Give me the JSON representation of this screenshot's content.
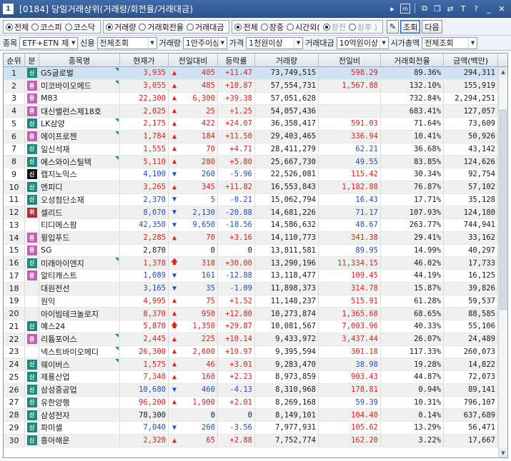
{
  "window": {
    "number": "1",
    "title": "[0184] 당일거래상위(거래량/회전율/거래대금)",
    "icons": [
      "arrow-right-icon",
      "m-box-icon",
      "window-split-icon",
      "copy-icon",
      "swap-icon",
      "font-size-icon",
      "help-icon",
      "minimize-icon",
      "close-icon"
    ]
  },
  "toolbar1": {
    "market": [
      {
        "label": "전체",
        "checked": true
      },
      {
        "label": "코스피",
        "checked": false
      },
      {
        "label": "코스닥",
        "checked": false
      }
    ],
    "sort": [
      {
        "label": "거래량",
        "checked": true
      },
      {
        "label": "거래회전율",
        "checked": false
      },
      {
        "label": "거래대금",
        "checked": false
      }
    ],
    "time": [
      {
        "label": "전체",
        "checked": true
      },
      {
        "label": "장중",
        "checked": false
      },
      {
        "label": "시간외(",
        "checked": false
      },
      {
        "label": "장전",
        "checked": true,
        "dim": true
      },
      {
        "label": "장후 )",
        "checked": false,
        "dim": true
      }
    ],
    "settings_icon": "wand-icon",
    "query_label": "조회",
    "next_label": "다음"
  },
  "toolbar2": {
    "item_label": "종목",
    "item_value": "ETF+ETN 제",
    "credit_label": "신용",
    "credit_value": "전체조회",
    "volume_label": "거래량",
    "volume_value": "1만주이상",
    "price_label": "가격",
    "price_value": "1천원이상",
    "amount_label": "거래대금",
    "amount_value": "10억원이상",
    "cap_label": "시가총액",
    "cap_value": "전체조회"
  },
  "table": {
    "columns": [
      "순위",
      "분",
      "종목명",
      "현재가",
      "전일대비",
      "등락률",
      "거래량",
      "전일비",
      "거래회전율",
      "금액(백만)"
    ],
    "rows": [
      {
        "rank": "1",
        "badge": "신",
        "badge_color": "green",
        "name": "GS글로벌",
        "mark": true,
        "price": "3,935",
        "dir": "up",
        "change": "405",
        "rate": "+11.47",
        "volume": "73,749,515",
        "prev_ratio": "598.29",
        "turnover": "89.36%",
        "amount": "294,311"
      },
      {
        "rank": "2",
        "badge": "증",
        "badge_color": "pink",
        "name": "미코바이오메드",
        "mark": true,
        "price": "3,055",
        "dir": "up",
        "change": "485",
        "rate": "+18.87",
        "volume": "57,554,731",
        "prev_ratio": "1,567.88",
        "turnover": "132.10%",
        "amount": "155,919"
      },
      {
        "rank": "3",
        "badge": "증",
        "badge_color": "pink",
        "name": "M83",
        "mark": false,
        "price": "22,300",
        "dir": "up",
        "change": "6,300",
        "rate": "+39.38",
        "volume": "57,051,628",
        "prev_ratio": "",
        "turnover": "732.84%",
        "amount": "2,294,251"
      },
      {
        "rank": "4",
        "badge": "증",
        "badge_color": "pink",
        "name": "대신밸런스제18호",
        "mark": false,
        "price": "2,025",
        "dir": "up",
        "change": "25",
        "rate": "+1.25",
        "volume": "54,057,436",
        "prev_ratio": "",
        "turnover": "683.41%",
        "amount": "127,057"
      },
      {
        "rank": "5",
        "badge": "신",
        "badge_color": "green",
        "name": "LK삼양",
        "mark": true,
        "price": "2,175",
        "dir": "up",
        "change": "422",
        "rate": "+24.07",
        "volume": "36,358,417",
        "prev_ratio": "591.03",
        "turnover": "71.64%",
        "amount": "73,609"
      },
      {
        "rank": "6",
        "badge": "증",
        "badge_color": "pink",
        "name": "에이프로젠",
        "mark": true,
        "price": "1,784",
        "dir": "up",
        "change": "184",
        "rate": "+11.50",
        "volume": "29,403,465",
        "prev_ratio": "336.94",
        "turnover": "10.41%",
        "amount": "50,926"
      },
      {
        "rank": "7",
        "badge": "신",
        "badge_color": "green",
        "name": "일신석재",
        "mark": false,
        "price": "1,555",
        "dir": "up",
        "change": "70",
        "rate": "+4.71",
        "volume": "28,411,279",
        "prev_ratio": "62.21",
        "turnover": "36.68%",
        "amount": "43,142"
      },
      {
        "rank": "8",
        "badge": "신",
        "badge_color": "green",
        "name": "에스와이스틸텍",
        "mark": true,
        "price": "5,110",
        "dir": "up",
        "change": "280",
        "rate": "+5.80",
        "volume": "25,667,730",
        "prev_ratio": "49.55",
        "turnover": "83.85%",
        "amount": "124,626"
      },
      {
        "rank": "9",
        "badge": "신",
        "badge_color": "black",
        "name": "랩지노믹스",
        "mark": false,
        "price": "4,100",
        "dir": "down",
        "change": "260",
        "rate": "-5.96",
        "volume": "22,526,081",
        "prev_ratio": "115.42",
        "turnover": "30.34%",
        "amount": "92,754"
      },
      {
        "rank": "10",
        "badge": "신",
        "badge_color": "green",
        "name": "엔피디",
        "mark": false,
        "price": "3,265",
        "dir": "up",
        "change": "345",
        "rate": "+11.82",
        "volume": "16,553,843",
        "prev_ratio": "1,182.88",
        "turnover": "76.87%",
        "amount": "57,102"
      },
      {
        "rank": "11",
        "badge": "신",
        "badge_color": "green",
        "name": "오성첨단소재",
        "mark": false,
        "price": "2,370",
        "dir": "down",
        "change": "5",
        "rate": "-0.21",
        "volume": "15,062,794",
        "prev_ratio": "16.43",
        "turnover": "17.71%",
        "amount": "35,128"
      },
      {
        "rank": "12",
        "badge": "위",
        "badge_color": "red",
        "name": "셀리드",
        "mark": false,
        "price": "8,070",
        "dir": "down",
        "change": "2,130",
        "rate": "-20.88",
        "volume": "14,681,226",
        "prev_ratio": "71.17",
        "turnover": "107.93%",
        "amount": "124,180"
      },
      {
        "rank": "13",
        "badge": "",
        "badge_color": "",
        "name": "티디에스팜",
        "mark": false,
        "price": "42,350",
        "dir": "down",
        "change": "9,650",
        "rate": "-18.56",
        "volume": "14,586,632",
        "prev_ratio": "48.67",
        "turnover": "263.77%",
        "amount": "744,941"
      },
      {
        "rank": "14",
        "badge": "증",
        "badge_color": "pink",
        "name": "윙입푸드",
        "mark": false,
        "price": "2,285",
        "dir": "up",
        "change": "70",
        "rate": "+3.16",
        "volume": "14,110,773",
        "prev_ratio": "341.38",
        "turnover": "29.41%",
        "amount": "33,162"
      },
      {
        "rank": "15",
        "badge": "증",
        "badge_color": "pink",
        "name": "SG",
        "mark": false,
        "price": "2,870",
        "dir": "flat",
        "change": "0",
        "rate": "0",
        "volume": "13,811,581",
        "prev_ratio": "89.95",
        "turnover": "14.99%",
        "amount": "40,297"
      },
      {
        "rank": "16",
        "badge": "신",
        "badge_color": "green",
        "name": "미래아이앤지",
        "mark": true,
        "price": "1,378",
        "dir": "upper",
        "change": "318",
        "rate": "+30.00",
        "volume": "13,290,196",
        "prev_ratio": "11,334.15",
        "turnover": "46.02%",
        "amount": "17,733"
      },
      {
        "rank": "17",
        "badge": "증",
        "badge_color": "pink",
        "name": "알티캐스트",
        "mark": false,
        "price": "1,089",
        "dir": "down",
        "change": "161",
        "rate": "-12.88",
        "volume": "13,118,477",
        "prev_ratio": "109.45",
        "turnover": "44.19%",
        "amount": "16,125"
      },
      {
        "rank": "18",
        "badge": "",
        "badge_color": "",
        "name": "대원전선",
        "mark": false,
        "price": "3,165",
        "dir": "down",
        "change": "35",
        "rate": "-1.09",
        "volume": "11,898,373",
        "prev_ratio": "314.78",
        "turnover": "15.87%",
        "amount": "39,826"
      },
      {
        "rank": "19",
        "badge": "",
        "badge_color": "",
        "name": "원익",
        "mark": false,
        "price": "4,995",
        "dir": "up",
        "change": "75",
        "rate": "+1.52",
        "volume": "11,148,237",
        "prev_ratio": "515.91",
        "turnover": "61.28%",
        "amount": "59,537"
      },
      {
        "rank": "20",
        "badge": "",
        "badge_color": "",
        "name": "아이빔테크놀로지",
        "mark": false,
        "price": "8,370",
        "dir": "up",
        "change": "950",
        "rate": "+12.80",
        "volume": "10,273,874",
        "prev_ratio": "1,365.68",
        "turnover": "68.65%",
        "amount": "88,585"
      },
      {
        "rank": "21",
        "badge": "신",
        "badge_color": "green",
        "name": "예스24",
        "mark": false,
        "price": "5,870",
        "dir": "upper",
        "change": "1,350",
        "rate": "+29.87",
        "volume": "10,081,567",
        "prev_ratio": "7,003.96",
        "turnover": "40.33%",
        "amount": "55,106"
      },
      {
        "rank": "22",
        "badge": "증",
        "badge_color": "pink",
        "name": "리튬포어스",
        "mark": true,
        "price": "2,445",
        "dir": "up",
        "change": "225",
        "rate": "+10.14",
        "volume": "9,433,972",
        "prev_ratio": "3,437.44",
        "turnover": "26.07%",
        "amount": "24,489"
      },
      {
        "rank": "23",
        "badge": "",
        "badge_color": "",
        "name": "넥스트바이오메디",
        "mark": true,
        "price": "26,300",
        "dir": "up",
        "change": "2,600",
        "rate": "+10.97",
        "volume": "9,395,594",
        "prev_ratio": "301.18",
        "turnover": "117.33%",
        "amount": "260,073"
      },
      {
        "rank": "24",
        "badge": "신",
        "badge_color": "green",
        "name": "웨이버스",
        "mark": true,
        "price": "1,575",
        "dir": "up",
        "change": "46",
        "rate": "+3.01",
        "volume": "9,283,470",
        "prev_ratio": "38.98",
        "turnover": "19.28%",
        "amount": "14,822"
      },
      {
        "rank": "25",
        "badge": "신",
        "badge_color": "green",
        "name": "제룡산업",
        "mark": false,
        "price": "7,340",
        "dir": "up",
        "change": "160",
        "rate": "+2.23",
        "volume": "8,973,859",
        "prev_ratio": "903.43",
        "turnover": "44.87%",
        "amount": "72,073"
      },
      {
        "rank": "26",
        "badge": "신",
        "badge_color": "green",
        "name": "삼성중공업",
        "mark": false,
        "price": "10,680",
        "dir": "down",
        "change": "460",
        "rate": "-4.13",
        "volume": "8,310,968",
        "prev_ratio": "178.81",
        "turnover": "0.94%",
        "amount": "89,141"
      },
      {
        "rank": "27",
        "badge": "신",
        "badge_color": "green",
        "name": "유한양행",
        "mark": false,
        "price": "96,200",
        "dir": "up",
        "change": "1,900",
        "rate": "+2.01",
        "volume": "8,269,168",
        "prev_ratio": "59.39",
        "turnover": "10.31%",
        "amount": "796,107"
      },
      {
        "rank": "28",
        "badge": "신",
        "badge_color": "green",
        "name": "삼성전자",
        "mark": false,
        "price": "78,300",
        "dir": "flat",
        "change": "0",
        "rate": "0",
        "volume": "8,149,101",
        "prev_ratio": "104.40",
        "turnover": "0.14%",
        "amount": "637,689"
      },
      {
        "rank": "29",
        "badge": "신",
        "badge_color": "green",
        "name": "파미셀",
        "mark": false,
        "price": "7,040",
        "dir": "down",
        "change": "260",
        "rate": "-3.56",
        "volume": "7,977,931",
        "prev_ratio": "105.62",
        "turnover": "13.29%",
        "amount": "56,471"
      },
      {
        "rank": "30",
        "badge": "신",
        "badge_color": "green",
        "name": "흥아해운",
        "mark": false,
        "price": "2,320",
        "dir": "up",
        "change": "65",
        "rate": "+2.88",
        "volume": "7,752,774",
        "prev_ratio": "162.20",
        "turnover": "3.22%",
        "amount": "17,667"
      }
    ]
  },
  "colors": {
    "up": "#e0241b",
    "down": "#1f4fc8",
    "selected_row": "#cfe3f5",
    "titlebar": "#2d5590"
  }
}
